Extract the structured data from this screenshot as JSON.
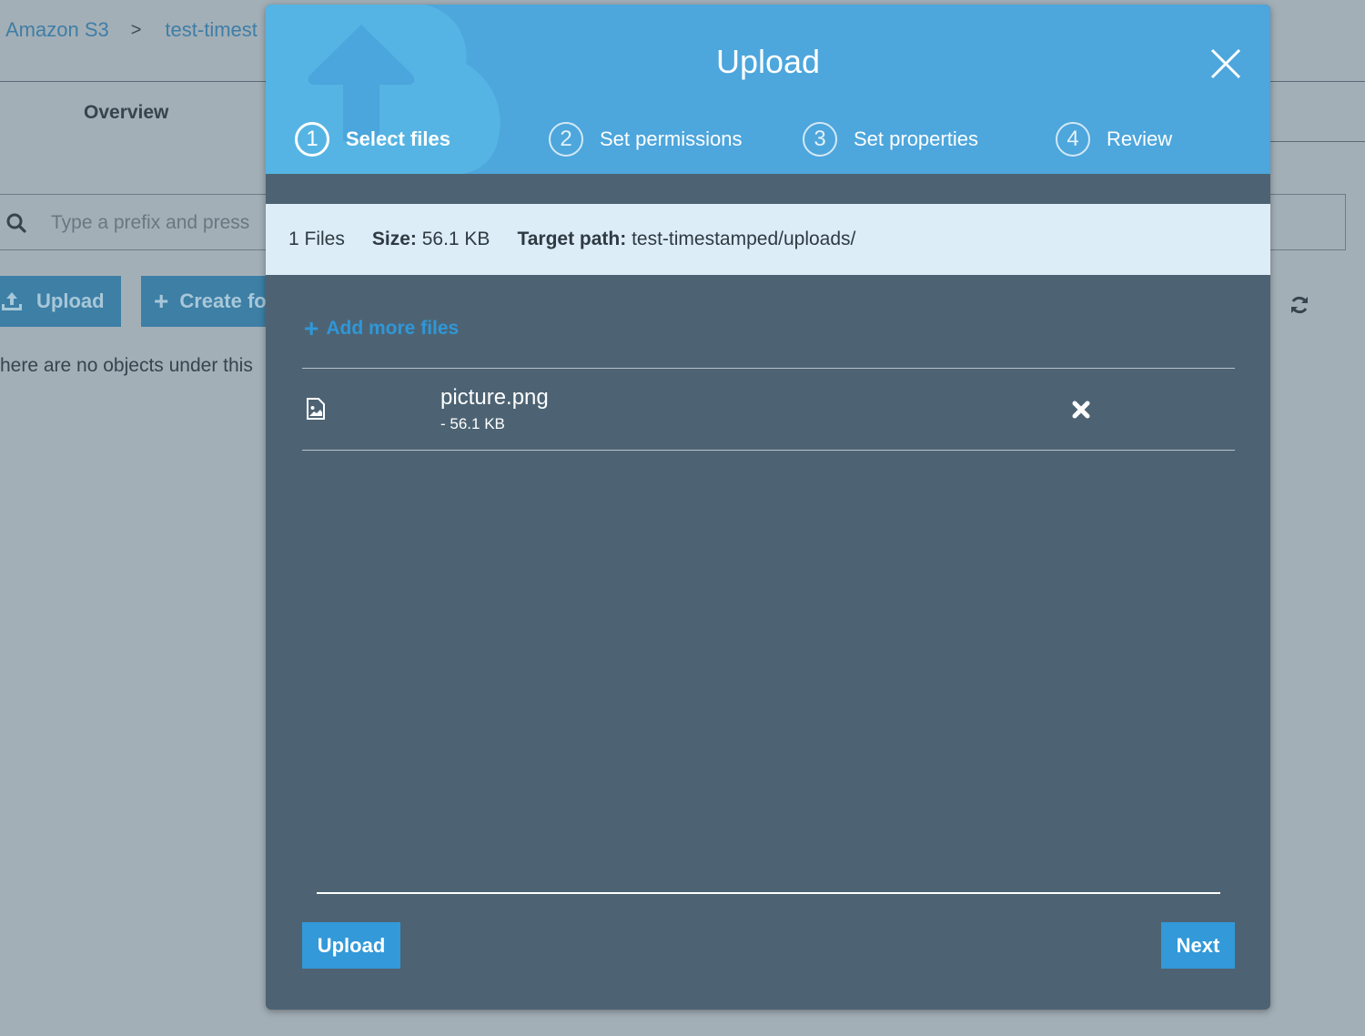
{
  "background": {
    "breadcrumb": [
      "Amazon S3",
      "test-timest"
    ],
    "breadcrumb_separator": ">",
    "tab_overview": "Overview",
    "search_placeholder": "Type a prefix and press",
    "upload_button": "Upload",
    "create_folder_button": "Create fo",
    "empty_message": "here are no objects under this"
  },
  "modal": {
    "title": "Upload",
    "steps": [
      {
        "number": "1",
        "label": "Select files",
        "active": true
      },
      {
        "number": "2",
        "label": "Set permissions",
        "active": false
      },
      {
        "number": "3",
        "label": "Set properties",
        "active": false
      },
      {
        "number": "4",
        "label": "Review",
        "active": false
      }
    ],
    "summary": {
      "files_count": "1 Files",
      "size_label": "Size:",
      "size_value": "56.1 KB",
      "target_label": "Target path:",
      "target_value": "test-timestamped/uploads/"
    },
    "add_more_label": "Add more files",
    "files": [
      {
        "name": "picture.png",
        "size": "- 56.1 KB",
        "icon": "image-file-icon"
      }
    ],
    "buttons": {
      "upload": "Upload",
      "next": "Next"
    }
  },
  "colors": {
    "header_blue": "#4da6dc",
    "modal_body": "#4d6373",
    "summary_bg": "#dcedf8",
    "primary_button": "#3399d8",
    "link_blue": "#2f97d8"
  }
}
